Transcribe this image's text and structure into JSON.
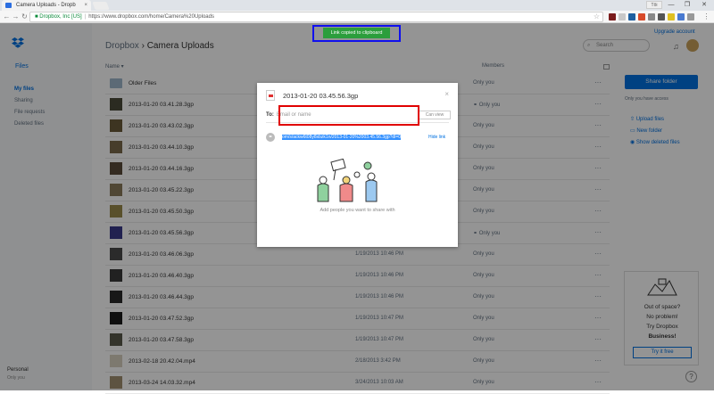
{
  "browser": {
    "tab_title": "Camera Uploads - Dropb",
    "tab_close": "×",
    "user_chip": "Tôi",
    "window_buttons": [
      "—",
      "❐",
      "✕"
    ],
    "back": "←",
    "forward": "→",
    "reload": "↻",
    "lock": "🔒",
    "secure_label": "Dropbox, Inc [US]",
    "url": "https://www.dropbox.com/home/Camera%20Uploads",
    "star": "☆",
    "menu": "⋮"
  },
  "sidebar": {
    "files_label": "Files",
    "items": [
      {
        "label": "My files",
        "active": true
      },
      {
        "label": "Sharing",
        "active": false
      },
      {
        "label": "File requests",
        "active": false
      },
      {
        "label": "Deleted files",
        "active": false
      }
    ],
    "account_name": "Personal",
    "account_sub": "Only you"
  },
  "header": {
    "breadcrumb_parent": "Dropbox",
    "breadcrumb_sep": " › ",
    "breadcrumb_current": "Camera Uploads",
    "search_placeholder": "Search",
    "upgrade_label": "Upgrade account"
  },
  "table": {
    "col_name": "Name ▾",
    "col_members": "Members",
    "rows": [
      {
        "name": "Older Files",
        "date": "",
        "members": "Only you",
        "folder": true,
        "thumb_color": "#9fb7cc"
      },
      {
        "name": "2013-01-20 03.41.28.3gp",
        "date": "",
        "members": "Only you",
        "shared": true,
        "thumb_color": "#4a4a3a"
      },
      {
        "name": "2013-01-20 03.43.02.3gp",
        "date": "",
        "members": "Only you",
        "thumb_color": "#6a5a3a"
      },
      {
        "name": "2013-01-20 03.44.10.3gp",
        "date": "",
        "members": "Only you",
        "thumb_color": "#7a6a4a"
      },
      {
        "name": "2013-01-20 03.44.16.3gp",
        "date": "",
        "members": "Only you",
        "thumb_color": "#5a4a3a"
      },
      {
        "name": "2013-01-20 03.45.22.3gp",
        "date": "",
        "members": "Only you",
        "thumb_color": "#8a7a5a"
      },
      {
        "name": "2013-01-20 03.45.50.3gp",
        "date": "",
        "members": "Only you",
        "thumb_color": "#9a8a4a"
      },
      {
        "name": "2013-01-20 03.45.56.3gp",
        "date": "1/19/2013 10:45 PM",
        "members": "Only you",
        "shared": true,
        "thumb_color": "#3a3a8a"
      },
      {
        "name": "2013-01-20 03.46.06.3gp",
        "date": "1/19/2013 10:46 PM",
        "members": "Only you",
        "thumb_color": "#4a4a4a"
      },
      {
        "name": "2013-01-20 03.46.40.3gp",
        "date": "1/19/2013 10:46 PM",
        "members": "Only you",
        "thumb_color": "#3a3a3a"
      },
      {
        "name": "2013-01-20 03.46.44.3gp",
        "date": "1/19/2013 10:46 PM",
        "members": "Only you",
        "thumb_color": "#2a2a2a"
      },
      {
        "name": "2013-01-20 03.47.52.3gp",
        "date": "1/19/2013 10:47 PM",
        "members": "Only you",
        "thumb_color": "#1a1a1a"
      },
      {
        "name": "2013-01-20 03.47.58.3gp",
        "date": "1/19/2013 10:47 PM",
        "members": "Only you",
        "thumb_color": "#5a5a4a"
      },
      {
        "name": "2013-02-18 20.42.04.mp4",
        "date": "2/18/2013 3:42 PM",
        "members": "Only you",
        "thumb_color": "#d8d0c0"
      },
      {
        "name": "2013-03-24 14.03.32.mp4",
        "date": "3/24/2013 10:03 AM",
        "members": "Only you",
        "thumb_color": "#a09070"
      }
    ]
  },
  "right_panel": {
    "share_folder": "Share folder",
    "only_you_access": "Only you have access",
    "actions": [
      {
        "icon": "⇧",
        "label": "Upload files"
      },
      {
        "icon": "▭",
        "label": "New folder"
      },
      {
        "icon": "◉",
        "label": "Show deleted files"
      }
    ],
    "promo_lines": [
      "Out of space?",
      "No problem!",
      "Try Dropbox",
      "Business!"
    ],
    "try_free": "Try it free",
    "help": "?"
  },
  "modal": {
    "title": "2013-01-20 03.45.56.3gp",
    "close": "×",
    "to_label": "To:",
    "to_placeholder": "Email or name",
    "can_view": "Can view",
    "link_url": "om/s/ackw6t08y8xbzk1n/2013-01-20%2003.45.56.3gp?dl=0",
    "hide_link": "Hide link",
    "caption": "Add people you want to share with"
  },
  "toast": {
    "text": "Link copied to clipboard"
  },
  "colors": {
    "accent": "#0070e0",
    "toast": "#2b9e3c",
    "annotation_red": "#e00000",
    "annotation_blue": "#1010ee"
  }
}
